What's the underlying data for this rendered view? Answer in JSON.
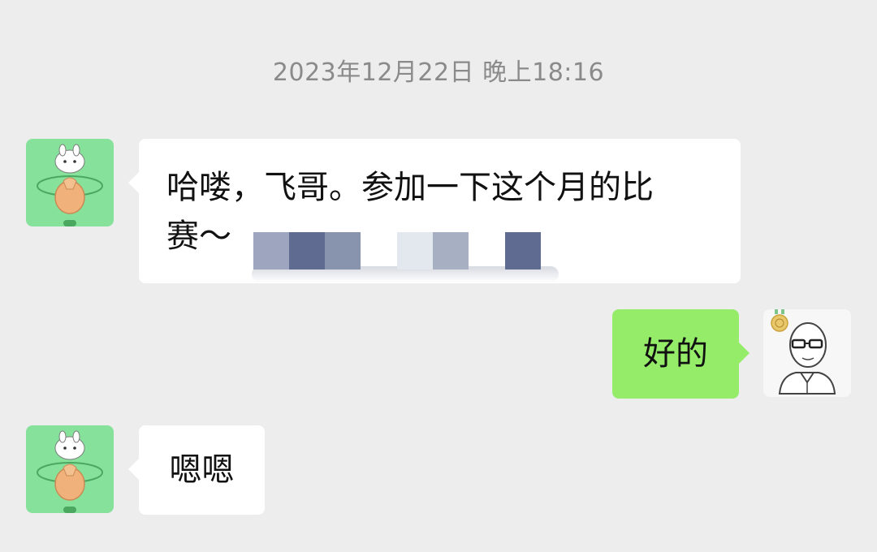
{
  "chat": {
    "timestamp": "2023年12月22日 晚上18:16",
    "messages": [
      {
        "sender": "contact",
        "avatar_icon": "bunny-heart-avatar-icon",
        "text_line1": "哈喽，飞哥。参加一下这个月的比",
        "text_line2": "赛～",
        "has_redacted_content": true
      },
      {
        "sender": "me",
        "avatar_icon": "bald-man-glasses-avatar-icon",
        "text": "好的"
      },
      {
        "sender": "contact",
        "avatar_icon": "bunny-heart-avatar-icon",
        "text": "嗯嗯"
      }
    ]
  },
  "colors": {
    "background": "#ededed",
    "incoming_bubble": "#ffffff",
    "outgoing_bubble": "#95ec69",
    "avatar_green": "#86e29b",
    "timestamp_text": "#8a8a8a",
    "redaction_dark": "#5f6b90",
    "redaction_mid": "#8893ad",
    "redaction_light": "#e3e7ee"
  }
}
